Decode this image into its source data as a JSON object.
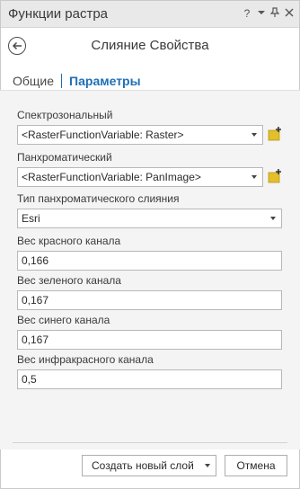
{
  "window": {
    "title": "Функции растра",
    "controls": {
      "help": "?",
      "menu": "▾",
      "pin": "📌",
      "close": "✕"
    }
  },
  "header": {
    "title": "Слияние Свойства",
    "back_icon": "back-arrow-icon"
  },
  "tabs": [
    {
      "label": "Общие",
      "active": false
    },
    {
      "label": "Параметры",
      "active": true
    }
  ],
  "params": {
    "multispectral": {
      "label": "Спектрозональный",
      "value": "<RasterFunctionVariable: Raster>"
    },
    "panchromatic": {
      "label": "Панхроматический",
      "value": "<RasterFunctionVariable: PanImage>"
    },
    "pan_type": {
      "label": "Тип панхроматического слияния",
      "value": "Esri"
    },
    "red_weight": {
      "label": "Вес красного канала",
      "value": "0,166"
    },
    "green_weight": {
      "label": "Вес зеленого канала",
      "value": "0,167"
    },
    "blue_weight": {
      "label": "Вес синего канала",
      "value": "0,167"
    },
    "ir_weight": {
      "label": "Вес инфракрасного канала",
      "value": "0,5"
    }
  },
  "footer": {
    "create_label": "Создать новый слой",
    "cancel_label": "Отмена"
  },
  "colors": {
    "accent": "#1f6fb5",
    "add_icon": "#e3c02a"
  }
}
